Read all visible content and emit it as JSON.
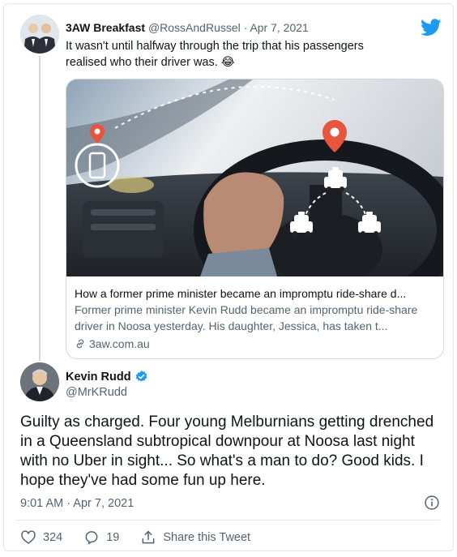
{
  "parent_tweet": {
    "display_name": "3AW Breakfast",
    "handle": "@RossAndRussel",
    "separator": "·",
    "date": "Apr 7, 2021",
    "text": "It wasn't until halfway through the trip that his passengers realised who their driver was. 😂",
    "link_card": {
      "title": "How a former prime minister became an impromptu ride-share d...",
      "description": "Former prime minister Kevin Rudd became an impromptu ride-share driver in Noosa yesterday. His daughter, Jessica, has taken t...",
      "domain": "3aw.com.au"
    }
  },
  "main_tweet": {
    "display_name": "Kevin Rudd",
    "handle": "@MrKRudd",
    "text": "Guilty as charged. Four young Melburnians getting drenched in a Queensland subtropical downpour at Noosa last night with no Uber in sight... So what's a man to do? Good kids. I hope they've had some fun up here.",
    "timestamp": "9:01 AM · Apr 7, 2021",
    "likes": "324",
    "replies": "19",
    "share_label": "Share this Tweet"
  },
  "colors": {
    "twitter_blue": "#1d9bf0",
    "secondary_text": "#536471",
    "border": "#e1e8ed",
    "pin_red": "#e8553e"
  },
  "icons": [
    "twitter-bird-icon",
    "verified-badge-icon",
    "link-icon",
    "info-icon",
    "heart-icon",
    "reply-icon",
    "share-icon",
    "location-pin-icon",
    "phone-icon",
    "car-icon"
  ]
}
